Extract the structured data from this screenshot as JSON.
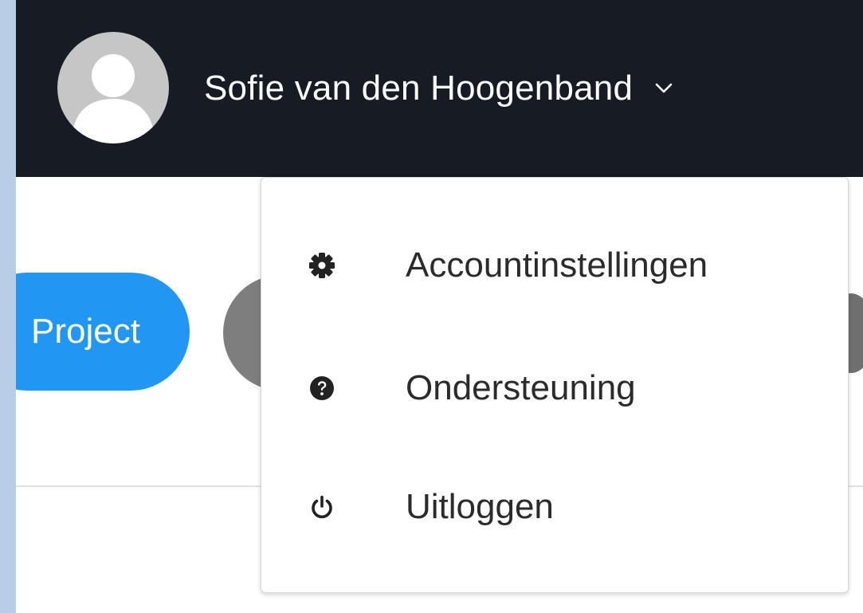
{
  "header": {
    "user_name": "Sofie van den Hoogenband",
    "avatar_icon": "user-avatar-icon",
    "dropdown_icon": "chevron-down-icon"
  },
  "toolbar": {
    "project_button_label": "Project"
  },
  "user_menu": {
    "items": [
      {
        "label": "Accountinstellingen",
        "icon": "gear-icon"
      },
      {
        "label": "Ondersteuning",
        "icon": "question-circle-icon"
      },
      {
        "label": "Uitloggen",
        "icon": "power-icon"
      }
    ]
  },
  "colors": {
    "topbar_bg": "#161b24",
    "accent_blue": "#2196f3",
    "page_bg": "#ffffff",
    "outer_bg": "#b9cde6"
  }
}
